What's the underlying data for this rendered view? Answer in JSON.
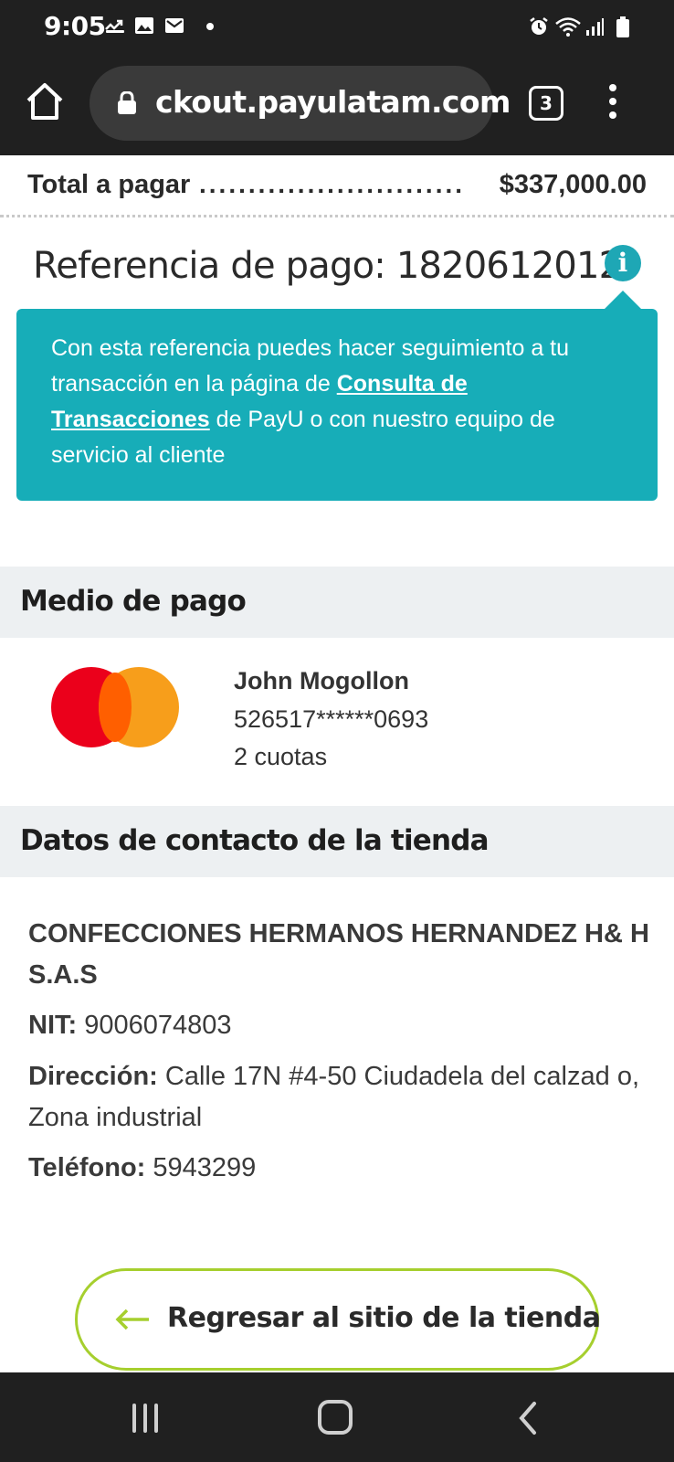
{
  "status_bar": {
    "time": "9:05",
    "icons": [
      "missed-call-icon",
      "gallery-icon",
      "mail-icon",
      "dot-icon",
      "alarm-icon",
      "wifi-icon",
      "signal-icon",
      "battery-icon"
    ]
  },
  "browser": {
    "url": "ckout.payulatam.com",
    "tab_count": "3",
    "icons": [
      "home-icon",
      "lock-icon",
      "more-vert-icon"
    ]
  },
  "total": {
    "label": "Total a pagar",
    "dots": "............................",
    "value": "$337,000.00"
  },
  "reference": {
    "title": "Referencia de pago: 1820612012",
    "info_icon": "i",
    "tooltip": {
      "text_before": "Con esta referencia puedes hacer seguimiento a tu transacción en la página de ",
      "link": "Consulta de Transacciones",
      "text_after": " de PayU o con nuestro equipo de servicio al cliente"
    }
  },
  "payment_method": {
    "header": "Medio de pago",
    "card_brand_icon": "mastercard-logo",
    "holder": "John Mogollon",
    "card_number": "526517******0693",
    "installments": "2 cuotas"
  },
  "store_contact": {
    "header": "Datos de contacto de la tienda",
    "name": "CONFECCIONES HERMANOS HERNANDEZ H& H S.A.S",
    "nit_label": "NIT:",
    "nit_value": "9006074803",
    "address_label": "Dirección:",
    "address_value": "Calle 17N #4-50 Ciudadela del calzad o, Zona industrial",
    "phone_label": "Teléfono:",
    "phone_value": "5943299"
  },
  "return_button": {
    "label": "Regresar al sitio de la tienda"
  },
  "colors": {
    "teal": "#17adb8",
    "lime": "#a6cf2e",
    "section_bg": "#edf0f2",
    "dark_bar": "#202020"
  }
}
